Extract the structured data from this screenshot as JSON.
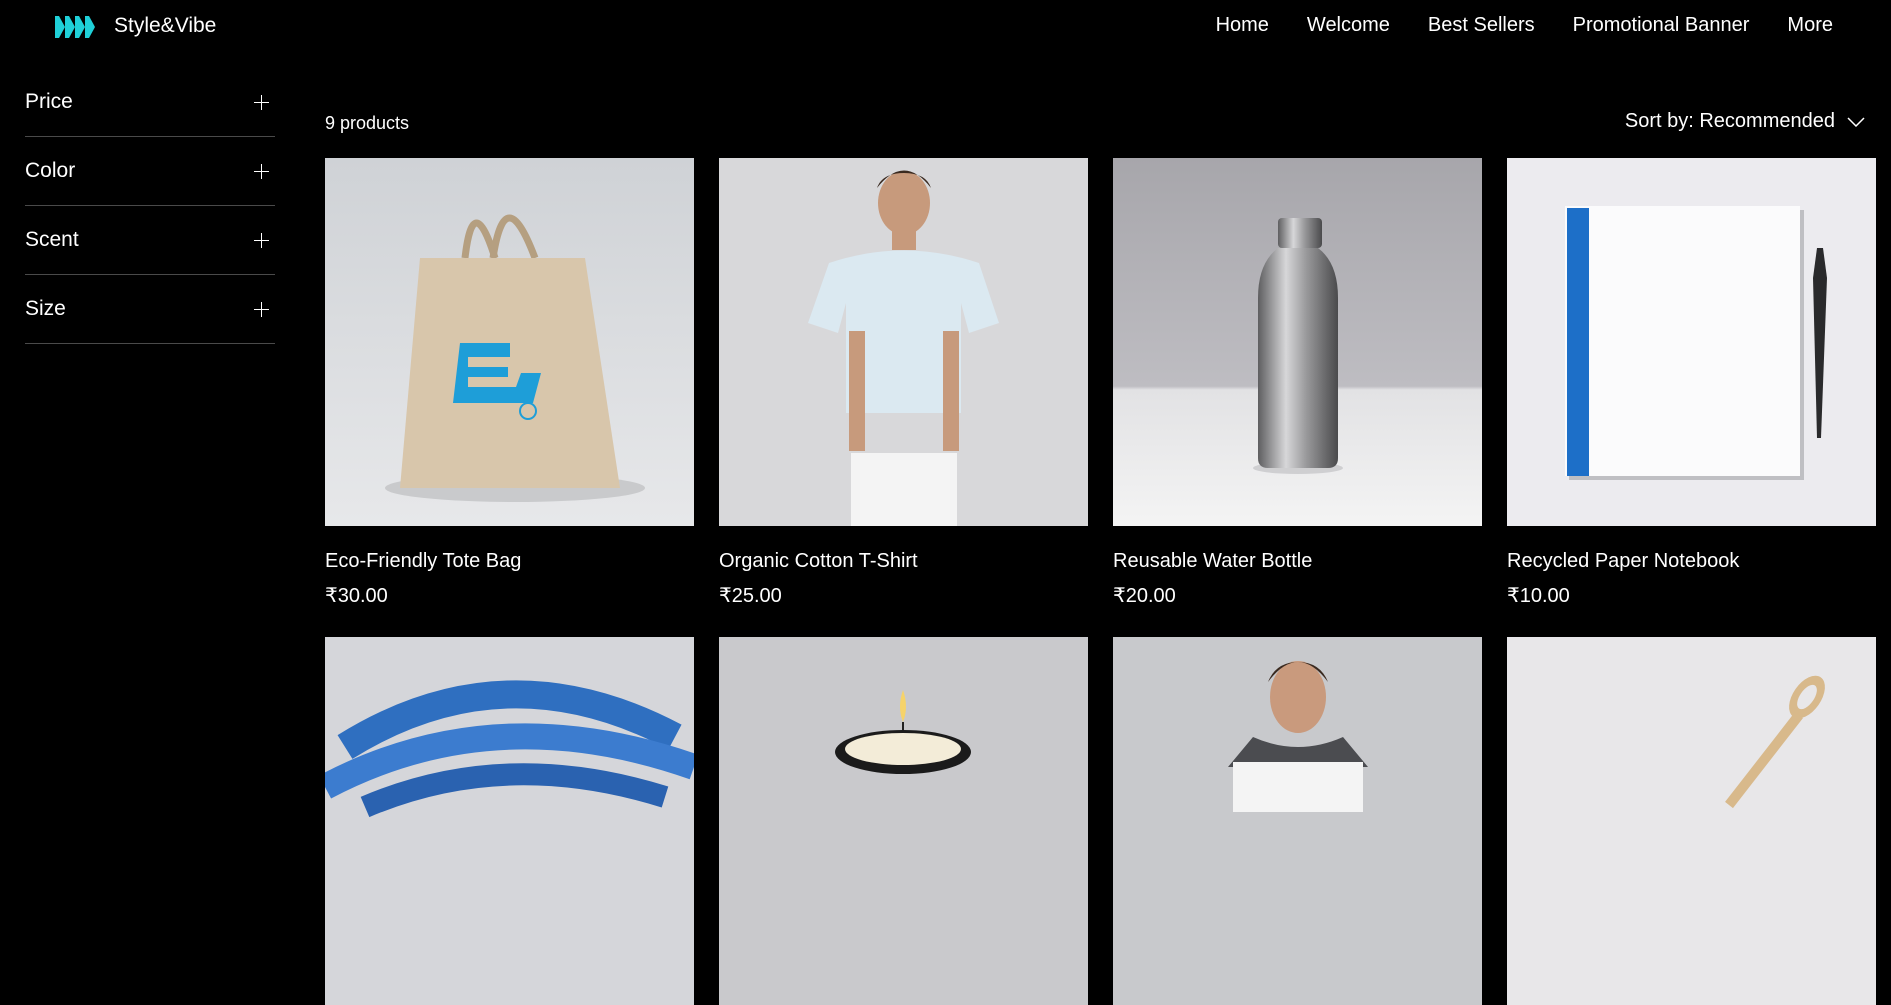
{
  "brand": {
    "name": "Style&Vibe",
    "accent": "#1FD0D8"
  },
  "nav": {
    "items": [
      "Home",
      "Welcome",
      "Best Sellers",
      "Promotional Banner",
      "More"
    ]
  },
  "filters": [
    {
      "label": "Price"
    },
    {
      "label": "Color"
    },
    {
      "label": "Scent"
    },
    {
      "label": "Size"
    }
  ],
  "catalog": {
    "count_text": "9 products",
    "sort_label": "Sort by: Recommended"
  },
  "products": [
    {
      "name": "Eco-Friendly Tote Bag",
      "price": "₹30.00",
      "image": "tote-bag"
    },
    {
      "name": "Organic Cotton T-Shirt",
      "price": "₹25.00",
      "image": "tshirt-model"
    },
    {
      "name": "Reusable Water Bottle",
      "price": "₹20.00",
      "image": "steel-bottle"
    },
    {
      "name": "Recycled Paper Notebook",
      "price": "₹10.00",
      "image": "notebook-pen"
    },
    {
      "name": "",
      "price": "",
      "image": "blue-yoga-strap"
    },
    {
      "name": "",
      "price": "",
      "image": "candle"
    },
    {
      "name": "",
      "price": "",
      "image": "scarf-model"
    },
    {
      "name": "",
      "price": "",
      "image": "bamboo-utensil"
    }
  ]
}
